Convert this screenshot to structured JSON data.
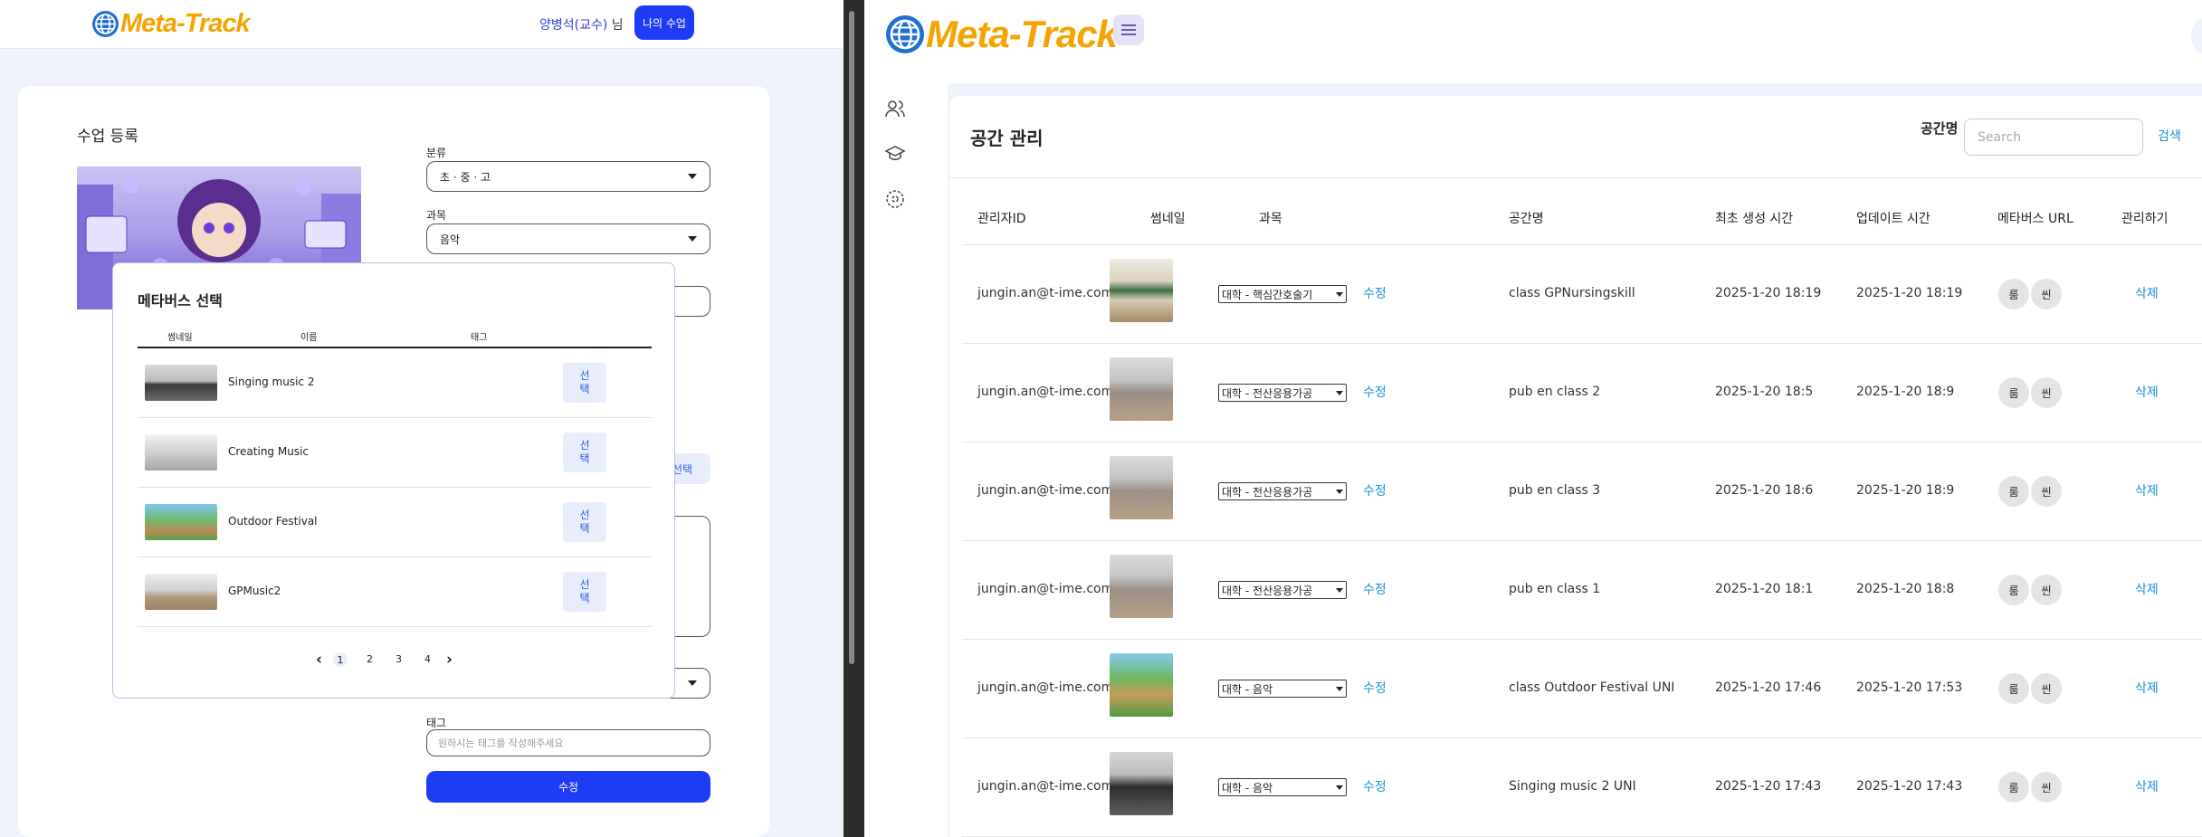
{
  "left_app": {
    "logo_text": "Meta-Track",
    "user_name": "양병석(교수)",
    "user_suffix": "님",
    "my_class_button": "나의 수업",
    "card_title": "수업 등록",
    "fields": {
      "category_label": "분류",
      "category_value": "초 · 중 · 고",
      "subject_label": "과목",
      "subject_value": "음악",
      "select_button_partial": "선택",
      "tag_label": "태그",
      "tag_placeholder": "원하시는 태그를 작성해주세요",
      "submit_button": "수정"
    },
    "modal": {
      "title": "메타버스 선택",
      "headers": [
        "썸네일",
        "이름",
        "태그"
      ],
      "rows": [
        {
          "name": "Singing music 2",
          "button": "선택"
        },
        {
          "name": "Creating Music",
          "button": "선택"
        },
        {
          "name": "Outdoor Festival",
          "button": "선택"
        },
        {
          "name": "GPMusic2",
          "button": "선택"
        }
      ],
      "pagination": {
        "prev": "‹",
        "pages": [
          "1",
          "2",
          "3",
          "4"
        ],
        "current": "1",
        "next": "›"
      }
    }
  },
  "right_app": {
    "logo_text": "Meta-Track",
    "page_title": "공간 관리",
    "search_label": "공간명",
    "search_placeholder": "Search",
    "search_button": "검색",
    "columns": [
      "관리자ID",
      "썸네일",
      "과목",
      "공간명",
      "최초 생성 시간",
      "업데이트 시간",
      "메타버스 URL",
      "관리하기"
    ],
    "rows": [
      {
        "admin_id": "jungin.an@t-ime.com",
        "subject": "대학 - 핵심간호술기",
        "edit": "수정",
        "space_name": "class GPNursingskill",
        "created": "2025-1-20 18:19",
        "updated": "2025-1-20 18:19",
        "url_room": "룸",
        "url_scene": "씬",
        "delete": "삭제"
      },
      {
        "admin_id": "jungin.an@t-ime.com",
        "subject": "대학 - 전산응용가공",
        "edit": "수정",
        "space_name": "pub en class 2",
        "created": "2025-1-20 18:5",
        "updated": "2025-1-20 18:9",
        "url_room": "룸",
        "url_scene": "씬",
        "delete": "삭제"
      },
      {
        "admin_id": "jungin.an@t-ime.com",
        "subject": "대학 - 전산응용가공",
        "edit": "수정",
        "space_name": "pub en class 3",
        "created": "2025-1-20 18:6",
        "updated": "2025-1-20 18:9",
        "url_room": "룸",
        "url_scene": "씬",
        "delete": "삭제"
      },
      {
        "admin_id": "jungin.an@t-ime.com",
        "subject": "대학 - 전산응용가공",
        "edit": "수정",
        "space_name": "pub en class 1",
        "created": "2025-1-20 18:1",
        "updated": "2025-1-20 18:8",
        "url_room": "룸",
        "url_scene": "씬",
        "delete": "삭제"
      },
      {
        "admin_id": "jungin.an@t-ime.com",
        "subject": "대학 - 음악",
        "edit": "수정",
        "space_name": "class Outdoor Festival UNI",
        "created": "2025-1-20 17:46",
        "updated": "2025-1-20 17:53",
        "url_room": "룸",
        "url_scene": "씬",
        "delete": "삭제"
      },
      {
        "admin_id": "jungin.an@t-ime.com",
        "subject": "대학 - 음악",
        "edit": "수정",
        "space_name": "Singing music 2 UNI",
        "created": "2025-1-20 17:43",
        "updated": "2025-1-20 17:43",
        "url_room": "룸",
        "url_scene": "씬",
        "delete": "삭제"
      }
    ],
    "sidebar_icons": [
      "users-icon",
      "graduation-cap-icon",
      "metaverse-icon"
    ]
  },
  "colors": {
    "brand_orange": "#f5a300",
    "primary_blue": "#1f3cf5",
    "link_blue": "#1e8fd6",
    "bg_light": "#eef2fb"
  }
}
